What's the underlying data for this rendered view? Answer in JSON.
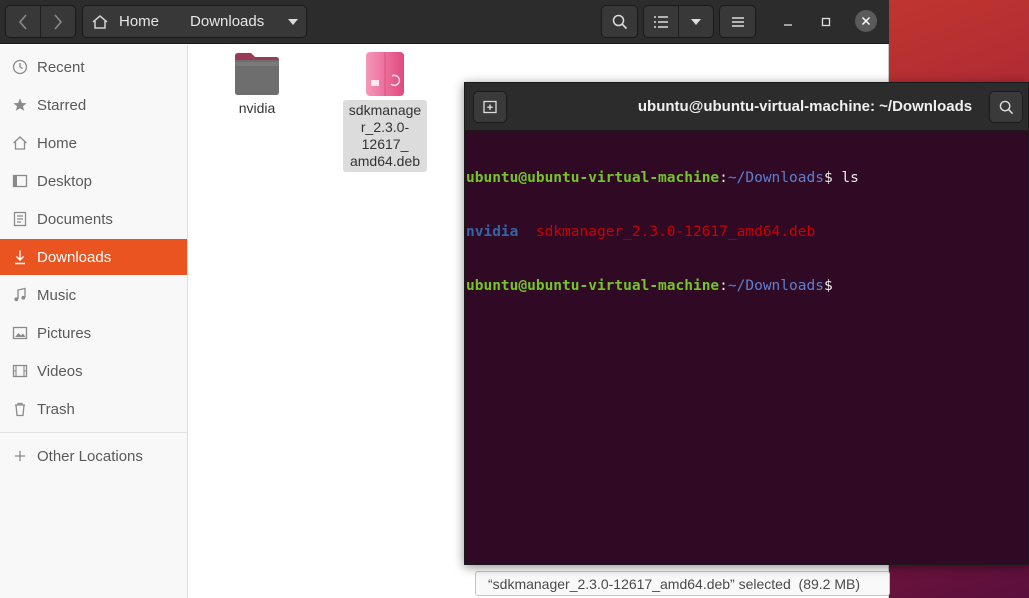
{
  "files_window": {
    "breadcrumb": [
      {
        "label": "Home",
        "icon": "home-icon"
      },
      {
        "label": "Downloads"
      }
    ],
    "sidebar": [
      {
        "label": "Recent",
        "icon": "clock-icon",
        "active": false
      },
      {
        "label": "Starred",
        "icon": "star-icon",
        "active": false
      },
      {
        "label": "Home",
        "icon": "home-icon",
        "active": false
      },
      {
        "label": "Desktop",
        "icon": "desktop-icon",
        "active": false
      },
      {
        "label": "Documents",
        "icon": "document-icon",
        "active": false
      },
      {
        "label": "Downloads",
        "icon": "download-icon",
        "active": true
      },
      {
        "label": "Music",
        "icon": "music-icon",
        "active": false
      },
      {
        "label": "Pictures",
        "icon": "picture-icon",
        "active": false
      },
      {
        "label": "Videos",
        "icon": "video-icon",
        "active": false
      },
      {
        "label": "Trash",
        "icon": "trash-icon",
        "active": false
      },
      {
        "label": "Other Locations",
        "icon": "plus-icon",
        "active": false
      }
    ],
    "files": [
      {
        "name": "nvidia",
        "type": "folder",
        "selected": false
      },
      {
        "name": "sdkmanager_2.3.0-12617_amd64.deb",
        "display_lines": [
          "sdkmanage",
          "r_2.3.0-",
          "12617_",
          "amd64.deb"
        ],
        "type": "deb-package",
        "selected": true
      }
    ],
    "status": "“sdkmanager_2.3.0-12617_amd64.deb” selected  (89.2 MB)"
  },
  "terminal": {
    "title": "ubuntu@ubuntu-virtual-machine: ~/Downloads",
    "lines": [
      {
        "user_host": "ubuntu@ubuntu-virtual-machine",
        "path": "~/Downloads",
        "prompt": "$",
        "command": " ls"
      },
      {
        "output": [
          {
            "text": "nvidia",
            "kind": "directory"
          },
          {
            "text": "sdkmanager_2.3.0-12617_amd64.deb",
            "kind": "archive"
          }
        ]
      },
      {
        "user_host": "ubuntu@ubuntu-virtual-machine",
        "path": "~/Downloads",
        "prompt": "$",
        "command": ""
      }
    ]
  },
  "colors": {
    "accent": "#e95420",
    "terminal_bg": "#300a24",
    "prompt_user": "#73c52b",
    "prompt_path": "#3465a4",
    "archive_file": "#cc0000"
  }
}
